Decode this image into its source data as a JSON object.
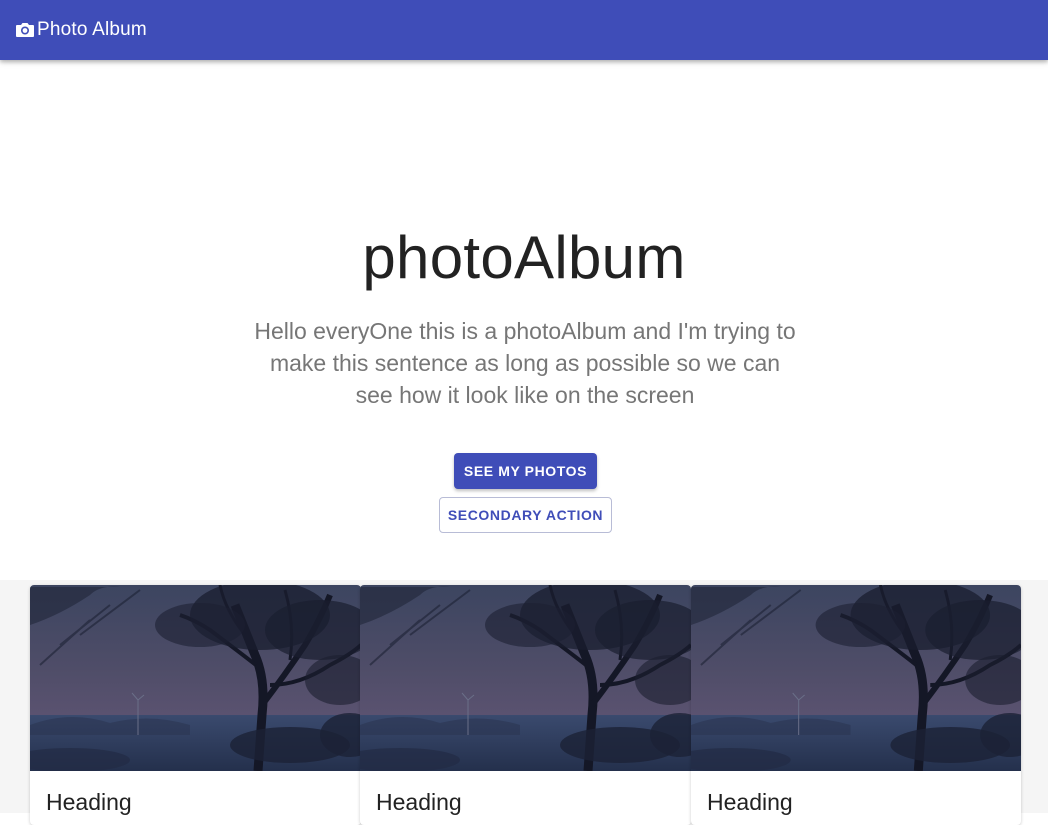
{
  "appbar": {
    "icon": "camera-icon",
    "title": "Photo Album",
    "color": "#3f4db8"
  },
  "hero": {
    "title": "photoAlbum",
    "text": "Hello everyOne this is a photoAlbum and I'm trying to make this sentence as long as possible so we can see how it look like on the screen",
    "primary_button": "SEE MY PHOTOS",
    "secondary_button": "SECONDARY ACTION"
  },
  "cards": [
    {
      "heading": "Heading",
      "image": "winter-tree-photo"
    },
    {
      "heading": "Heading",
      "image": "winter-tree-photo"
    },
    {
      "heading": "Heading",
      "image": "winter-tree-photo"
    }
  ]
}
